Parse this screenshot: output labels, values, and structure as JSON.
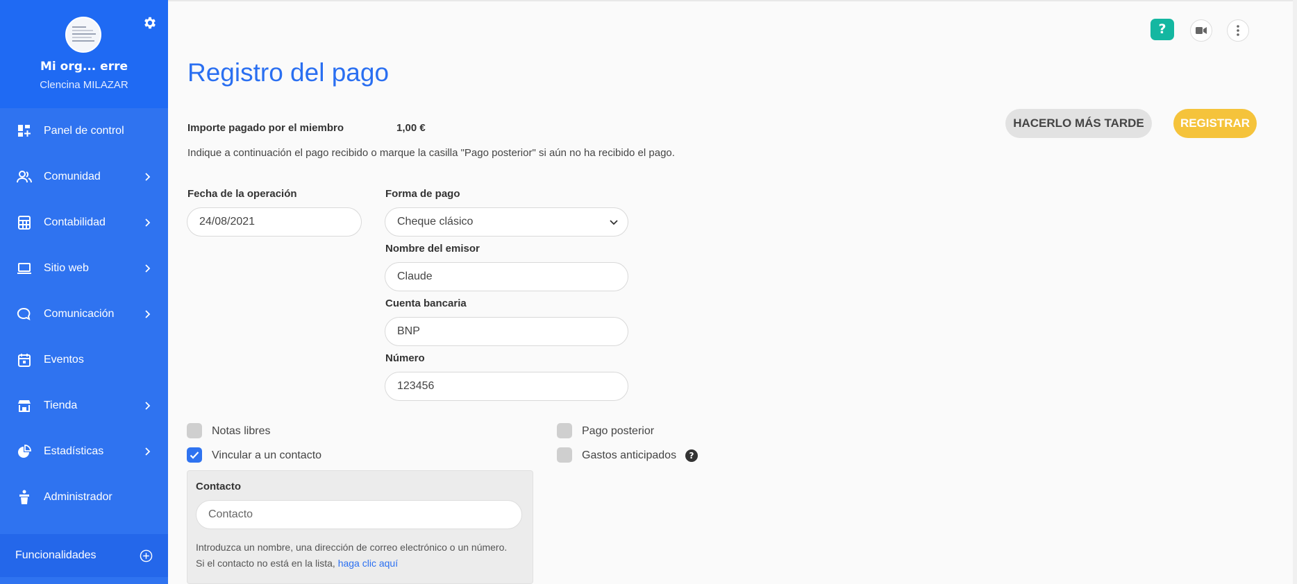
{
  "sidebar": {
    "org_name": "Mi org... erre",
    "user_name": "Clencina MILAZAR",
    "items": [
      {
        "label": "Panel de control",
        "icon": "dashboard-icon",
        "has_chevron": false
      },
      {
        "label": "Comunidad",
        "icon": "community-icon",
        "has_chevron": true
      },
      {
        "label": "Contabilidad",
        "icon": "calculator-icon",
        "has_chevron": true
      },
      {
        "label": "Sitio web",
        "icon": "laptop-icon",
        "has_chevron": true
      },
      {
        "label": "Comunicación",
        "icon": "chat-icon",
        "has_chevron": true
      },
      {
        "label": "Eventos",
        "icon": "calendar-icon",
        "has_chevron": false
      },
      {
        "label": "Tienda",
        "icon": "store-icon",
        "has_chevron": true
      },
      {
        "label": "Estadísticas",
        "icon": "pie-chart-icon",
        "has_chevron": true
      },
      {
        "label": "Administrador",
        "icon": "admin-icon",
        "has_chevron": false
      }
    ],
    "footer_label": "Funcionalidades"
  },
  "topbar": {
    "help_glyph": "?"
  },
  "page": {
    "title": "Registro del pago",
    "amount_label": "Importe pagado por el miembro",
    "amount_value": "1,00 €",
    "description": "Indique a continuación el pago recibido o marque la casilla \"Pago posterior\" si aún no ha recibido el pago."
  },
  "actions": {
    "later_label": "HACERLO MÁS TARDE",
    "register_label": "REGISTRAR"
  },
  "form": {
    "date_label": "Fecha de la operación",
    "date_value": "24/08/2021",
    "payment_method_label": "Forma de pago",
    "payment_method_value": "Cheque clásico",
    "issuer_label": "Nombre del emisor",
    "issuer_value": "Claude",
    "bank_label": "Cuenta bancaria",
    "bank_value": "BNP",
    "number_label": "Número",
    "number_value": "123456"
  },
  "options": {
    "free_notes_label": "Notas libres",
    "free_notes_checked": false,
    "link_contact_label": "Vincular a un contacto",
    "link_contact_checked": true,
    "later_payment_label": "Pago posterior",
    "later_payment_checked": false,
    "advance_expenses_label": "Gastos anticipados",
    "advance_expenses_checked": false,
    "help_glyph": "?"
  },
  "contact": {
    "label": "Contacto",
    "placeholder": "Contacto",
    "help_line1": "Introduzca un nombre, una dirección de correo electrónico o un número.",
    "help_line2_prefix": "Si el contacto no está en la lista,",
    "help_link": "haga clic aquí"
  },
  "colors": {
    "sidebar": "#2f73f0",
    "accent": "#2a6ff1",
    "register_button": "#f5c33b",
    "help_button": "#14b7a1"
  }
}
